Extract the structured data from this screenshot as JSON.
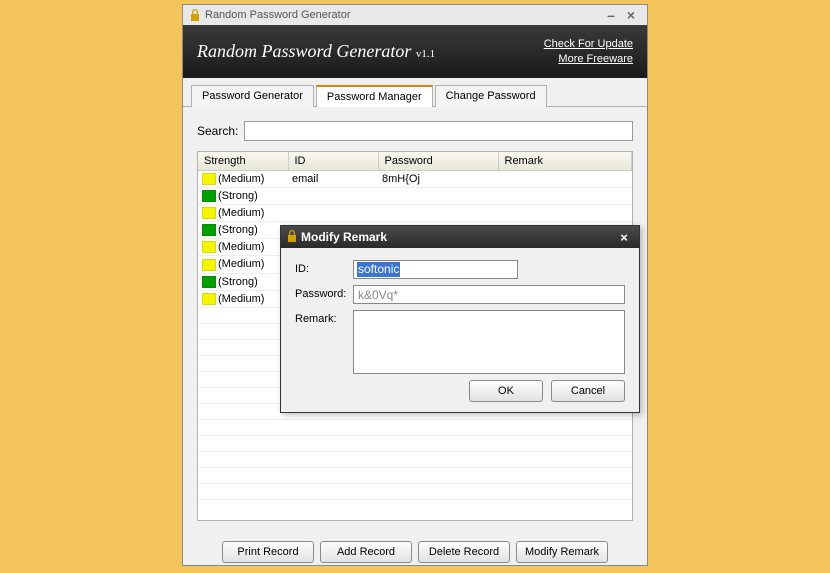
{
  "window": {
    "title": "Random Password Generator",
    "header_title": "Random Password Generator",
    "header_version": "v1.1",
    "link_update": "Check For Update",
    "link_freeware": "More Freeware"
  },
  "tabs": [
    {
      "label": "Password Generator",
      "active": false
    },
    {
      "label": "Password Manager",
      "active": true
    },
    {
      "label": "Change Password",
      "active": false
    }
  ],
  "search": {
    "label": "Search:",
    "value": ""
  },
  "grid": {
    "columns": [
      "Strength",
      "ID",
      "Password",
      "Remark"
    ],
    "rows": [
      {
        "strength": "(Medium)",
        "color": "#f5f500",
        "id": "email",
        "password": "8mH{Oj",
        "remark": ""
      },
      {
        "strength": "(Strong)",
        "color": "#00a000",
        "id": "",
        "password": "",
        "remark": ""
      },
      {
        "strength": "(Medium)",
        "color": "#f5f500",
        "id": "",
        "password": "",
        "remark": ""
      },
      {
        "strength": "(Strong)",
        "color": "#00a000",
        "id": "",
        "password": "",
        "remark": ""
      },
      {
        "strength": "(Medium)",
        "color": "#f5f500",
        "id": "",
        "password": "",
        "remark": ""
      },
      {
        "strength": "(Medium)",
        "color": "#f5f500",
        "id": "",
        "password": "",
        "remark": ""
      },
      {
        "strength": "(Strong)",
        "color": "#00a000",
        "id": "",
        "password": "",
        "remark": ""
      },
      {
        "strength": "(Medium)",
        "color": "#f5f500",
        "id": "",
        "password": "",
        "remark": ""
      }
    ]
  },
  "footer": {
    "print": "Print Record",
    "add": "Add Record",
    "delete": "Delete Record",
    "modify": "Modify Remark"
  },
  "dialog": {
    "title": "Modify Remark",
    "id_label": "ID:",
    "id_value": "softonic",
    "password_label": "Password:",
    "password_value": "k&0Vq*",
    "remark_label": "Remark:",
    "remark_value": "",
    "ok": "OK",
    "cancel": "Cancel"
  }
}
